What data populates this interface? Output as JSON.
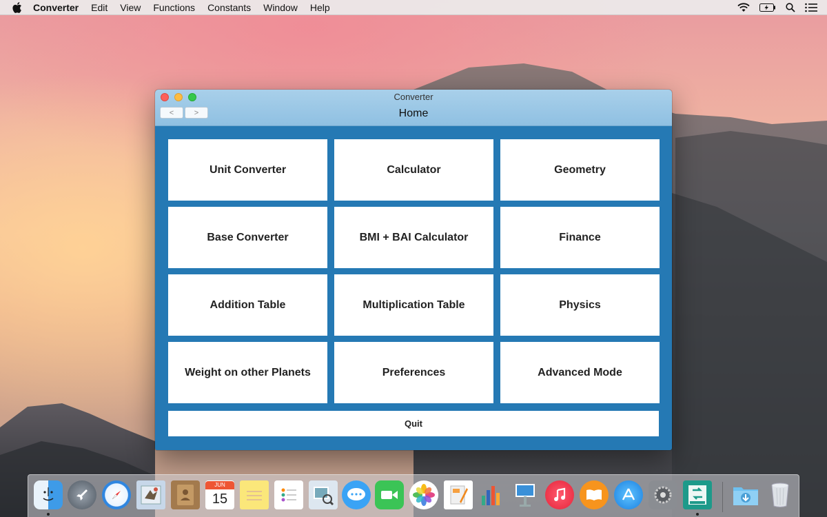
{
  "menubar": {
    "app_name": "Converter",
    "items": [
      "Edit",
      "View",
      "Functions",
      "Constants",
      "Window",
      "Help"
    ],
    "status_icons": [
      "wifi-icon",
      "battery-icon",
      "spotlight-icon",
      "notification-center-icon"
    ]
  },
  "window": {
    "title": "Converter",
    "nav_title": "Home",
    "back_label": "<",
    "forward_label": ">",
    "tiles": [
      "Unit Converter",
      "Calculator",
      "Geometry",
      "Base Converter",
      "BMI + BAI Calculator",
      "Finance",
      "Addition Table",
      "Multiplication Table",
      "Physics",
      "Weight on other Planets",
      "Preferences",
      "Advanced Mode"
    ],
    "quit_label": "Quit"
  },
  "dock": {
    "calendar_month": "JUN",
    "calendar_day": "15",
    "apps": [
      "finder-icon",
      "launchpad-icon",
      "safari-icon",
      "mail-icon",
      "contacts-icon",
      "calendar-icon",
      "notes-icon",
      "reminders-icon",
      "preview-icon",
      "messages-icon",
      "facetime-icon",
      "photos-icon",
      "pages-icon",
      "numbers-icon",
      "keynote-icon",
      "itunes-icon",
      "ibooks-icon",
      "app-store-icon",
      "system-preferences-icon",
      "converter-icon",
      "downloads-folder-icon",
      "trash-icon"
    ]
  },
  "colors": {
    "window_background": "#2579b4",
    "titlebar": "#a9d0ea",
    "tile_background": "#ffffff"
  }
}
